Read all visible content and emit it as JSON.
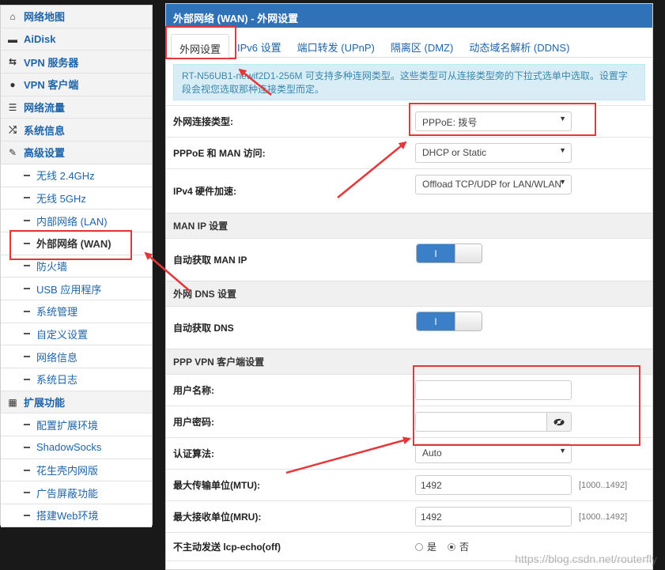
{
  "sidebar": {
    "items": [
      {
        "label": "网络地图",
        "icon": "home-icon",
        "glyph": "⌂",
        "type": "top"
      },
      {
        "label": "AiDisk",
        "icon": "hdd-icon",
        "glyph": "▬",
        "type": "top"
      },
      {
        "label": "VPN 服务器",
        "icon": "retweet-icon",
        "glyph": "⇆",
        "type": "top"
      },
      {
        "label": "VPN 客户端",
        "icon": "globe-icon",
        "glyph": "●",
        "type": "top"
      },
      {
        "label": "网络流量",
        "icon": "list-icon",
        "glyph": "☰",
        "type": "top"
      },
      {
        "label": "系统信息",
        "icon": "random-icon",
        "glyph": "⤮",
        "type": "top"
      },
      {
        "label": "高级设置",
        "icon": "wrench-icon",
        "glyph": "✎",
        "type": "top"
      },
      {
        "label": "无线 2.4GHz",
        "type": "sub"
      },
      {
        "label": "无线 5GHz",
        "type": "sub"
      },
      {
        "label": "内部网络 (LAN)",
        "type": "sub"
      },
      {
        "label": "外部网络 (WAN)",
        "type": "sub",
        "active": true
      },
      {
        "label": "防火墙",
        "type": "sub"
      },
      {
        "label": "USB 应用程序",
        "type": "sub"
      },
      {
        "label": "系统管理",
        "type": "sub"
      },
      {
        "label": "自定义设置",
        "type": "sub"
      },
      {
        "label": "网络信息",
        "type": "sub"
      },
      {
        "label": "系统日志",
        "type": "sub"
      },
      {
        "label": "扩展功能",
        "icon": "grid-icon",
        "glyph": "▦",
        "type": "top"
      },
      {
        "label": "配置扩展环境",
        "type": "sub"
      },
      {
        "label": "ShadowSocks",
        "type": "sub"
      },
      {
        "label": "花生壳内网版",
        "type": "sub"
      },
      {
        "label": "广告屏蔽功能",
        "type": "sub"
      },
      {
        "label": "搭建Web环境",
        "type": "sub"
      }
    ]
  },
  "header": {
    "title": "外部网络 (WAN) - 外网设置"
  },
  "tabs": [
    "外网设置",
    "IPv6 设置",
    "端口转发 (UPnP)",
    "隔离区 (DMZ)",
    "动态域名解析 (DDNS)"
  ],
  "info_text": "RT-N56UB1-newif2D1-256M 可支持多种连网类型。这些类型可从连接类型旁的下拉式选单中选取。设置字段会视您选取那种连接类型而定。",
  "form": {
    "wan_type": {
      "label": "外网连接类型:",
      "value": "PPPoE: 拨号"
    },
    "man_access": {
      "label": "PPPoE 和 MAN 访问:",
      "value": "DHCP or Static"
    },
    "hw_accel": {
      "label": "IPv4 硬件加速:",
      "value": "Offload TCP/UDP for LAN/WLAN"
    },
    "man_ip_section": "MAN IP 设置",
    "auto_man_ip": {
      "label": "自动获取 MAN IP",
      "value": "I"
    },
    "dns_section": "外网 DNS 设置",
    "auto_dns": {
      "label": "自动获取 DNS",
      "value": "I"
    },
    "ppp_section": "PPP VPN 客户端设置",
    "username": {
      "label": "用户名称:",
      "value": ""
    },
    "password": {
      "label": "用户密码:",
      "value": ""
    },
    "auth": {
      "label": "认证算法:",
      "value": "Auto"
    },
    "mtu": {
      "label": "最大传输单位(MTU):",
      "value": "1492",
      "range": "[1000..1492]"
    },
    "mru": {
      "label": "最大接收单位(MRU):",
      "value": "1492",
      "range": "[1000..1492]"
    },
    "lcp": {
      "label": "不主动发送 lcp-echo(off)",
      "yes": "是",
      "no": "否",
      "selected": "否"
    }
  },
  "watermark": "https://blog.csdn.net/routerfly"
}
